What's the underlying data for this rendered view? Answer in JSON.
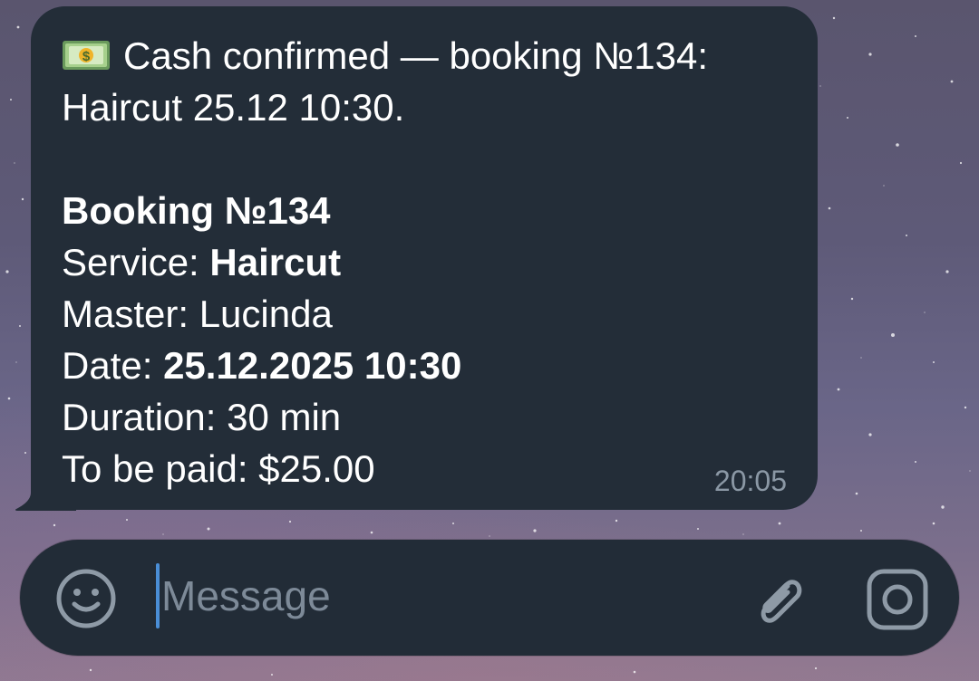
{
  "chat": {
    "message": {
      "header_emoji": "money-banknote-icon",
      "line1": "Cash confirmed — booking №134:",
      "line2": "Haircut 25.12 10:30.",
      "booking_title": "Booking №134",
      "service_label": "Service: ",
      "service_value": "Haircut",
      "master_label": "Master: ",
      "master_value": "Lucinda",
      "date_label": "Date: ",
      "date_value": "25.12.2025 10:30",
      "duration_label": "Duration: ",
      "duration_value": "30 min",
      "paid_label": "To be paid: ",
      "paid_value": "$25.00",
      "time": "20:05"
    }
  },
  "composer": {
    "placeholder": "Message",
    "value": "",
    "emoji_icon": "smiley-icon",
    "attach_icon": "paperclip-icon",
    "camera_icon": "camera-icon"
  },
  "colors": {
    "bubble_bg": "#232d38",
    "input_bg": "#222c37",
    "timestamp": "#8b98a5",
    "caret": "#4a8ed6",
    "icon": "#8e9aa6"
  }
}
